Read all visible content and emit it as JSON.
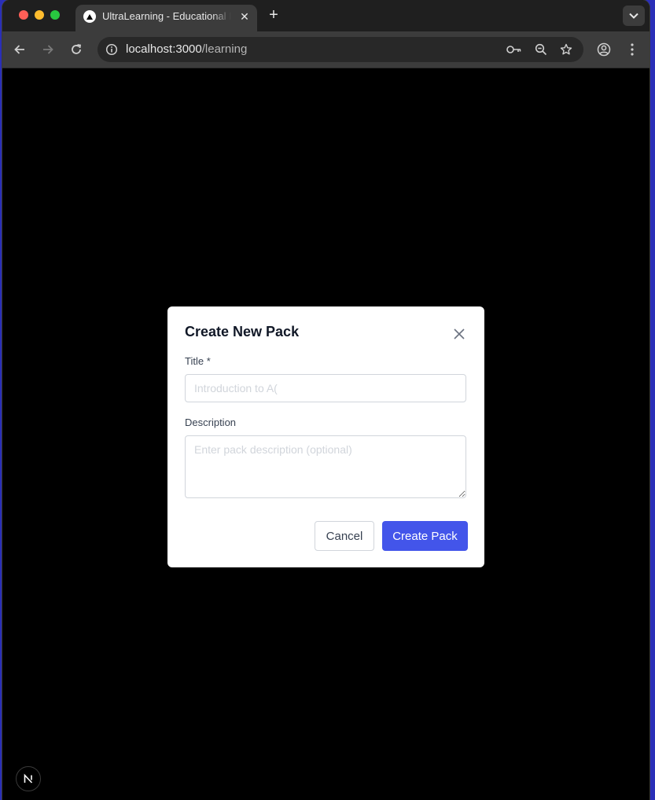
{
  "browser": {
    "tab": {
      "title": "UltraLearning - Educational Platform",
      "close_icon": "close-icon",
      "favicon": "triangle-logo-icon"
    },
    "new_tab_label": "+",
    "url_host": "localhost:3000",
    "url_path": "/learning",
    "icons": [
      "back-arrow-icon",
      "forward-arrow-icon",
      "reload-icon",
      "site-info-icon",
      "password-key-icon",
      "zoom-icon",
      "bookmark-star-icon",
      "profile-icon",
      "more-menu-icon",
      "tab-search-chevron-icon"
    ]
  },
  "modal": {
    "title": "Create New Pack",
    "title_field": {
      "label": "Title *",
      "placeholder": "Introduction to A(",
      "value": ""
    },
    "description_field": {
      "label": "Description",
      "placeholder": "Enter pack description (optional)",
      "value": ""
    },
    "cancel_label": "Cancel",
    "create_label": "Create Pack"
  },
  "dev_badge": {
    "label": "N"
  },
  "colors": {
    "page_background": "#000000",
    "modal_background": "#ffffff",
    "primary_button": "#4355ea",
    "browser_chrome": "#3c3c3c",
    "tab_strip": "#1f1f1f",
    "desktop": "#2a2fb8"
  }
}
